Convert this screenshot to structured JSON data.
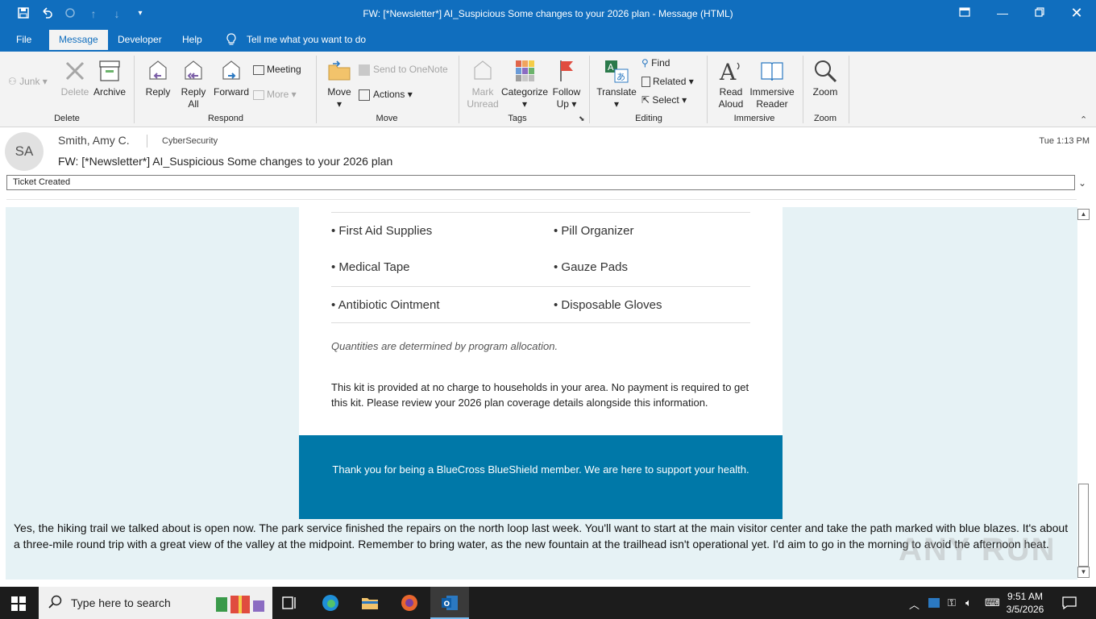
{
  "window": {
    "title": "FW: [*Newsletter*] AI_Suspicious Some changes to your 2026 plan  -  Message (HTML)"
  },
  "menu": {
    "tabs": [
      "File",
      "Message",
      "Developer",
      "Help"
    ],
    "tell_me": "Tell me what you want to do"
  },
  "ribbon": {
    "delete_group": {
      "junk": "Junk",
      "delete": "Delete",
      "archive": "Archive",
      "label": "Delete"
    },
    "respond_group": {
      "reply": "Reply",
      "reply_all_1": "Reply",
      "reply_all_2": "All",
      "forward": "Forward",
      "meeting": "Meeting",
      "more": "More",
      "label": "Respond"
    },
    "move_group": {
      "move": "Move",
      "send_onenote": "Send to OneNote",
      "actions": "Actions",
      "label": "Move"
    },
    "tags_group": {
      "mark_unread_1": "Mark",
      "mark_unread_2": "Unread",
      "categorize": "Categorize",
      "follow_up_1": "Follow",
      "follow_up_2": "Up",
      "label": "Tags"
    },
    "editing_group": {
      "translate": "Translate",
      "find": "Find",
      "related": "Related",
      "select": "Select",
      "label": "Editing"
    },
    "immersive_group": {
      "read_aloud_1": "Read",
      "read_aloud_2": "Aloud",
      "immersive_reader_1": "Immersive",
      "immersive_reader_2": "Reader",
      "label": "Immersive"
    },
    "zoom_group": {
      "zoom": "Zoom",
      "label": "Zoom"
    }
  },
  "message": {
    "avatar_initials": "SA",
    "sender": "Smith, Amy C.",
    "to": "CyberSecurity",
    "time": "Tue 1:13 PM",
    "subject": "FW: [*Newsletter*] AI_Suspicious Some changes to your 2026 plan",
    "category": "Ticket Created"
  },
  "body": {
    "items": [
      [
        "• First Aid Supplies",
        "• Pill Organizer"
      ],
      [
        "• Medical Tape",
        "• Gauze Pads"
      ],
      [
        "• Antibiotic Ointment",
        "• Disposable Gloves"
      ]
    ],
    "note": "Quantities are determined by program allocation.",
    "paragraph": "This kit is provided at no charge to households in your area. No payment is required to get this kit. Please review your 2026 plan coverage details alongside this information.",
    "footer": "Thank you for being a BlueCross BlueShield member. We are here to support your health.",
    "plain_text": "Yes, the hiking trail we talked about is open now. The park service finished the repairs on the north loop last week. You'll want to start at the main visitor center and take the path marked with blue blazes. It's about a three-mile round trip with a great view of the valley at the midpoint. Remember to bring water, as the new fountain at the trailhead isn't operational yet. I'd aim to go in the morning to avoid the afternoon heat."
  },
  "watermark": "ANY RUN",
  "taskbar": {
    "search_placeholder": "Type here to search",
    "time": "9:51 AM",
    "date": "3/5/2026"
  },
  "colors": {
    "titlebar": "#106ebe",
    "body_bg": "#e6f2f5",
    "footer_bg": "#0078a8"
  }
}
